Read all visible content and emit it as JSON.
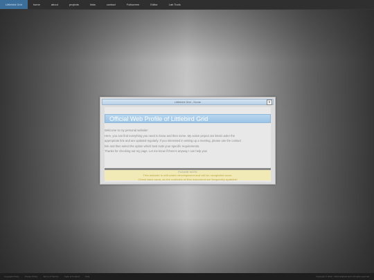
{
  "nav": {
    "brand": "Littlebird Grid",
    "items": [
      "home",
      "about",
      "projects",
      "links",
      "contact",
      "Fullscreen",
      "Editor",
      "Lab Tools"
    ]
  },
  "modal": {
    "title": "Littlebird Grid - Home",
    "close_label": "x",
    "heading": "Official Web Profile of Littlebird Grid",
    "paragraphs": [
      "Welcome to my personal website!",
      "Here, you can find everything you need to know and then some. My active project are listed under the",
      "appropriate link and are updated regularly. If you interested in setting up a meeting, please use the contact",
      "link and then select the option which best suits your specific requirements.",
      "Thanks for checking out my page. Let me know if there's anyway I can help you!"
    ],
    "note": {
      "title": "PLEASE NOTE",
      "line1": "This website is still under development and will be completed soon.",
      "line2": "Check back soon, as the contents of this document are frequently updated!"
    }
  },
  "footer": {
    "links": [
      "Copyright Policy",
      "Privacy Policy",
      "Terms of Service",
      "Code of Conduct",
      "FAQ"
    ],
    "copyright": "Copyright © 2013 - 2014 Littlebird Grid. All rights reserved."
  },
  "colors": {
    "brand_bg": "#3b6e99",
    "header_blue": "#9cc4e6",
    "note_bg": "#f1eab7",
    "note_text": "#c9b55a"
  }
}
